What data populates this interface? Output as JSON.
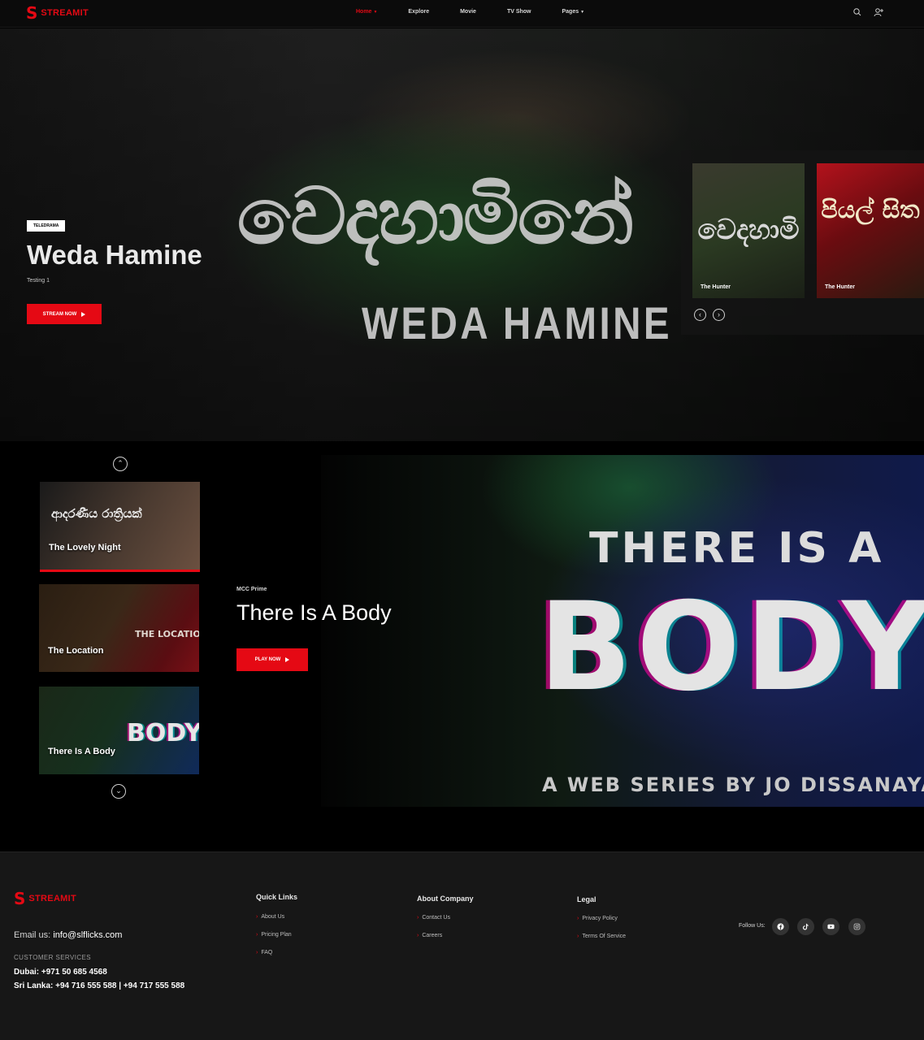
{
  "nav": {
    "logo_letter": "S",
    "logo_text": "STREAMIT",
    "menu": [
      {
        "label": "Home",
        "active": true,
        "dropdown": true
      },
      {
        "label": "Explore",
        "active": false,
        "dropdown": false
      },
      {
        "label": "Movie",
        "active": false,
        "dropdown": false
      },
      {
        "label": "TV Show",
        "active": false,
        "dropdown": false
      },
      {
        "label": "Pages",
        "active": false,
        "dropdown": true
      }
    ],
    "icons": [
      "search-icon",
      "user-add-icon"
    ]
  },
  "hero": {
    "badge": "TELEDRAMA",
    "title": "Weda Hamine",
    "description": "Testing 1",
    "button_label": "STREAM NOW",
    "poster_title_sinhala": "වෙදහාමිනේ",
    "poster_title_latin": "WEDA HAMINE",
    "carousel": [
      {
        "label": "The Hunter",
        "art": "වෙදහාමි"
      },
      {
        "label": "The Hunter",
        "art": "පියල් සිත"
      }
    ]
  },
  "featured": {
    "provider": "MCC Prime",
    "title": "There Is A Body",
    "button_label": "PLAY NOW",
    "poster_line1": "THERE IS A",
    "poster_line2": "BODY",
    "poster_line3": "A WEB SERIES BY JO DISSANAYAKE",
    "thumbnails": [
      {
        "label": "The Lovely Night",
        "art": "ආදරණීය රාත්‍රියක්"
      },
      {
        "label": "The Location",
        "art": "THE LOCATION"
      },
      {
        "label": "There Is A Body",
        "art": "BODY"
      }
    ]
  },
  "footer": {
    "logo_letter": "S",
    "logo_text": "STREAMIT",
    "email_label": "Email us:",
    "email": "info@slflicks.com",
    "customer_services": "CUSTOMER SERVICES",
    "phones": [
      "Dubai: +971 50 685 4568",
      "Sri Lanka: +94 716 555 588 | +94 717 555 588"
    ],
    "columns": [
      {
        "heading": "Quick Links",
        "links": [
          "About Us",
          "Pricing Plan",
          "FAQ"
        ]
      },
      {
        "heading": "About Company",
        "links": [
          "Contact Us",
          "Careers"
        ]
      },
      {
        "heading": "Legal",
        "links": [
          "Privacy Policy",
          "Terms Of Service"
        ]
      }
    ],
    "follow_label": "Follow Us:",
    "social_icons": [
      "facebook-icon",
      "tiktok-icon",
      "youtube-icon",
      "instagram-icon"
    ]
  },
  "colors": {
    "accent": "#e50914",
    "background": "#000000",
    "footer": "#171717"
  }
}
